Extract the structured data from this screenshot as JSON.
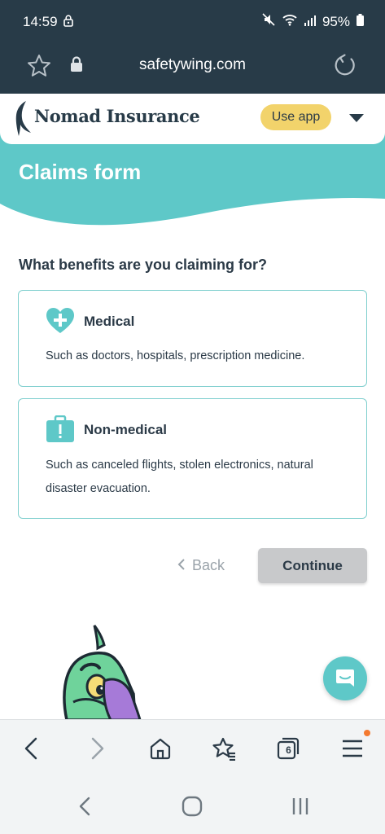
{
  "status_bar": {
    "time": "14:59",
    "battery": "95%"
  },
  "browser": {
    "url": "safetywing.com",
    "tab_count": "6"
  },
  "site": {
    "logo_text": "Nomad Insurance",
    "use_app_label": "Use app"
  },
  "page": {
    "title": "Claims form",
    "question": "What benefits are you claiming for?",
    "options": [
      {
        "title": "Medical",
        "description": "Such as doctors, hospitals, prescription medicine."
      },
      {
        "title": "Non-medical",
        "description": "Such as canceled flights, stolen electronics, natural disaster evacuation."
      }
    ],
    "back_label": "Back",
    "continue_label": "Continue"
  },
  "colors": {
    "status_bar_bg": "#283b48",
    "hero_teal": "#5ec8c8",
    "card_border": "#7fcfce",
    "use_app_bg": "#f2d36b",
    "continue_bg": "#c8c9cb",
    "notification_dot": "#f47a30"
  },
  "icons": {
    "status": [
      "lock-icon",
      "mute-icon",
      "wifi-icon",
      "signal-icon",
      "battery-icon"
    ],
    "url_bar": [
      "star-icon",
      "lock-icon",
      "reload-icon"
    ],
    "options": [
      "heart-plus-icon",
      "suitcase-alert-icon"
    ],
    "toolbar": [
      "back-arrow-icon",
      "forward-arrow-icon",
      "home-icon",
      "bookmarks-icon",
      "tabs-icon",
      "menu-icon"
    ],
    "system_nav": [
      "back-icon",
      "home-circle-icon",
      "recents-icon"
    ]
  }
}
